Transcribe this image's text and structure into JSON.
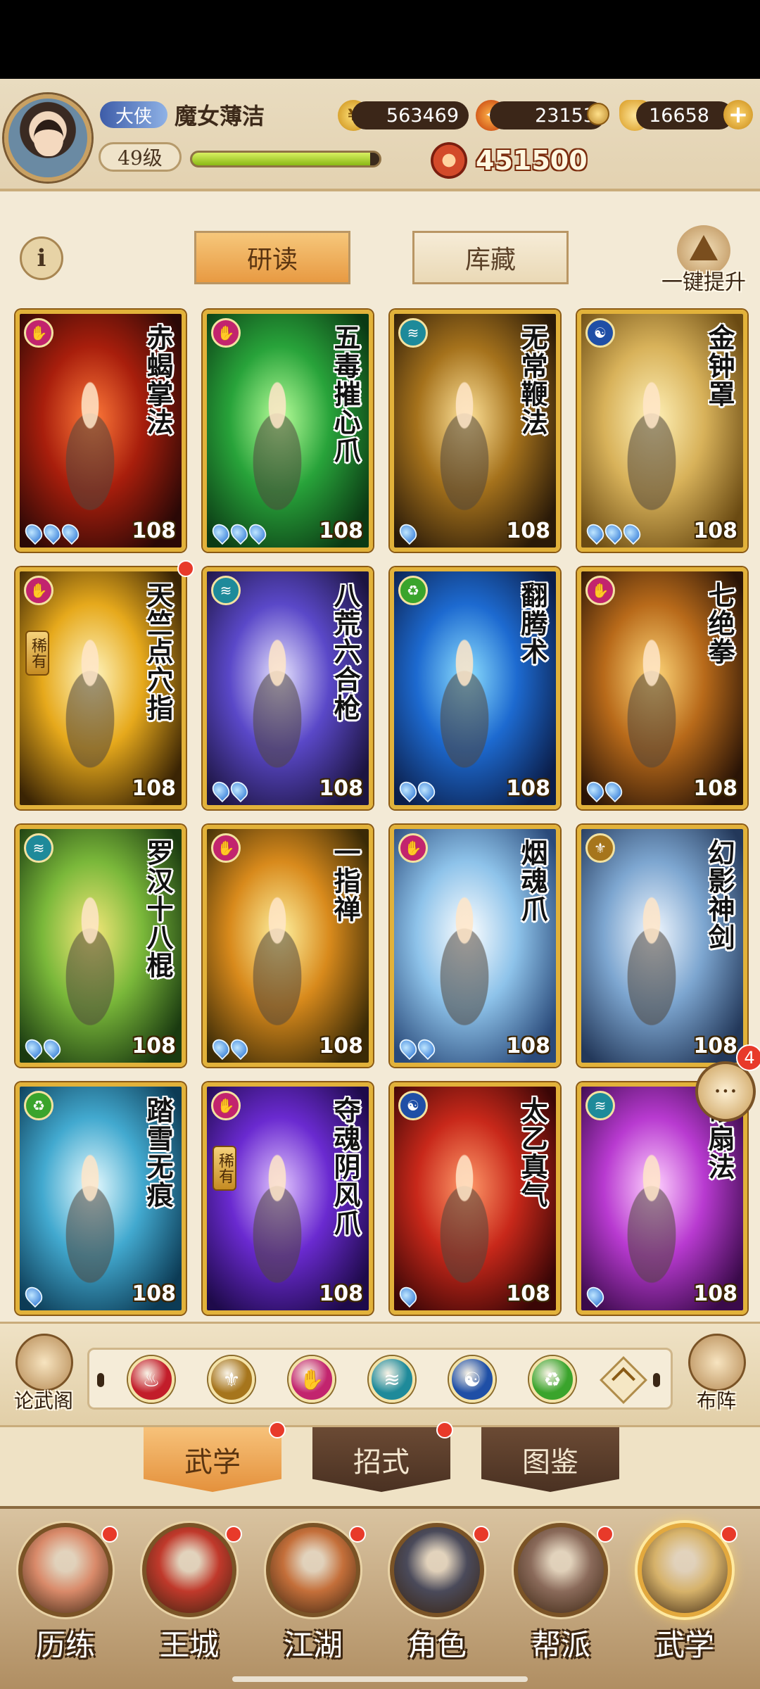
{
  "player": {
    "title": "大侠",
    "name": "魔女薄洁",
    "level": "49级",
    "exp_fraction": 0.95,
    "power": "451500"
  },
  "resources": {
    "coins": "563469",
    "flame": "23153",
    "ingots": "16658"
  },
  "tabs": {
    "study": "研读",
    "storage": "库藏",
    "upgrade_all": "一键提升"
  },
  "element_colors": {
    "fire": "#c21d2a",
    "gold": "#a6751c",
    "poison": "#c2246e",
    "water": "#1e8a9a",
    "yin": "#1f4fa6",
    "wood": "#3aa42c"
  },
  "cards": [
    {
      "name": "赤蝎掌法",
      "level": "108",
      "stars": 3,
      "element": "poison",
      "rare": false,
      "bg": [
        "#2a0806",
        "#a81e0c",
        "#ff7a3a"
      ]
    },
    {
      "name": "五毒摧心爪",
      "level": "108",
      "stars": 3,
      "element": "poison",
      "rare": false,
      "bg": [
        "#0b3a14",
        "#28a33a",
        "#b8ff9a"
      ]
    },
    {
      "name": "无常鞭法",
      "level": "108",
      "stars": 1,
      "element": "water",
      "rare": false,
      "bg": [
        "#2a1a08",
        "#a5721c",
        "#ffe39a"
      ]
    },
    {
      "name": "金钟罩",
      "level": "108",
      "stars": 3,
      "element": "yin",
      "rare": false,
      "bg": [
        "#6a4a12",
        "#d8b25a",
        "#fff1b8"
      ]
    },
    {
      "name": "天竺点穴指",
      "level": "108",
      "stars": 0,
      "element": "poison",
      "rare": true,
      "rare_label": "稀有",
      "red_dot": true,
      "bg": [
        "#3a2404",
        "#e6a91c",
        "#fff6c2"
      ]
    },
    {
      "name": "八荒六合枪",
      "level": "108",
      "stars": 2,
      "element": "water",
      "rare": false,
      "bg": [
        "#1c1440",
        "#5a48c8",
        "#e8e4ff"
      ]
    },
    {
      "name": "翻腾术",
      "level": "108",
      "stars": 2,
      "element": "wood",
      "rare": false,
      "bg": [
        "#0b1e4a",
        "#1d6ad0",
        "#8ee0ff"
      ]
    },
    {
      "name": "七绝拳",
      "level": "108",
      "stars": 2,
      "element": "poison",
      "rare": false,
      "bg": [
        "#2a1406",
        "#b86a1a",
        "#ffd77a"
      ]
    },
    {
      "name": "罗汉十八棍",
      "level": "108",
      "stars": 2,
      "element": "water",
      "rare": false,
      "bg": [
        "#1a3a10",
        "#7ab83a",
        "#f6e87a"
      ]
    },
    {
      "name": "一指禅",
      "level": "108",
      "stars": 2,
      "element": "poison",
      "rare": false,
      "bg": [
        "#3a2a06",
        "#d88a1c",
        "#fff2a0"
      ]
    },
    {
      "name": "烟魂爪",
      "level": "108",
      "stars": 2,
      "element": "poison",
      "rare": false,
      "bg": [
        "#2a4a7a",
        "#8ec3ea",
        "#ffffff"
      ]
    },
    {
      "name": "幻影神剑",
      "level": "108",
      "stars": 0,
      "element": "gold",
      "rare": false,
      "bg": [
        "#23385a",
        "#7da6d0",
        "#f2f8ff"
      ]
    },
    {
      "name": "踏雪无痕",
      "level": "108",
      "stars": 1,
      "element": "wood",
      "rare": false,
      "bg": [
        "#0c3b55",
        "#42a9cf",
        "#e8fbff"
      ]
    },
    {
      "name": "夺魂阴风爪",
      "level": "108",
      "stars": 0,
      "element": "poison",
      "rare": true,
      "rare_label": "稀有",
      "bg": [
        "#1e0a4a",
        "#6a2ad0",
        "#e2c6ff"
      ]
    },
    {
      "name": "太乙真气",
      "level": "108",
      "stars": 1,
      "element": "yin",
      "rare": false,
      "bg": [
        "#3a0606",
        "#c8281a",
        "#ff9a6a"
      ]
    },
    {
      "name": "砂扇法",
      "level": "108",
      "stars": 1,
      "element": "water",
      "rare": false,
      "bg": [
        "#3a0a4a",
        "#b83ad0",
        "#ffd2ff"
      ]
    }
  ],
  "chat": {
    "count": "4"
  },
  "filter": {
    "left_label": "论武阁",
    "right_label": "布阵",
    "icons": [
      "fire",
      "gold",
      "poison",
      "water",
      "yin",
      "wood"
    ]
  },
  "subtabs": [
    "武学",
    "招式",
    "图鉴"
  ],
  "nav": [
    {
      "label": "历练",
      "color": "#d98a6a"
    },
    {
      "label": "王城",
      "color": "#c0392b"
    },
    {
      "label": "江湖",
      "color": "#c46f3a"
    },
    {
      "label": "角色",
      "color": "#4a4a5a"
    },
    {
      "label": "帮派",
      "color": "#8a6a5a"
    },
    {
      "label": "武学",
      "color": "#d6b26a"
    }
  ]
}
